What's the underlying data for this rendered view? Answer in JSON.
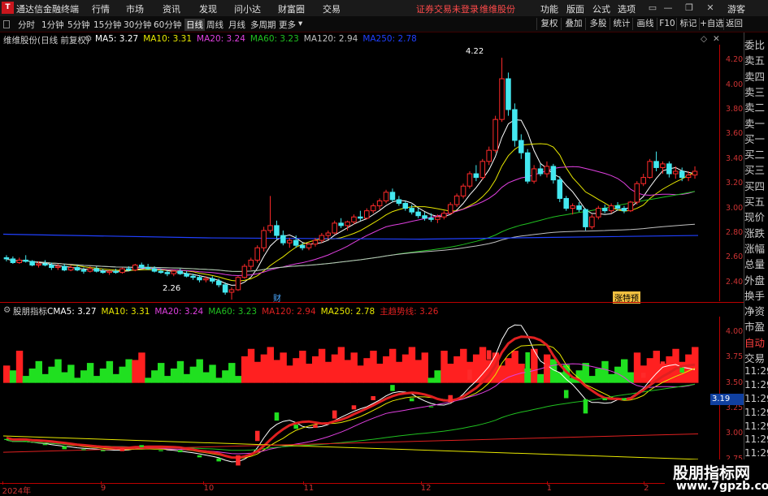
{
  "topbar": {
    "app_title": "通达信金融终端",
    "menus": [
      "行情",
      "市场",
      "资讯",
      "发现",
      "问小达",
      "财富圈",
      "交易"
    ],
    "status": "证券交易未登录",
    "stock_name": "维维股份",
    "right_menus": [
      "功能",
      "版面",
      "公式",
      "选项"
    ],
    "guest": "游客"
  },
  "periods": [
    "分时",
    "1分钟",
    "5分钟",
    "15分钟",
    "30分钟",
    "60分钟",
    "日线",
    "周线",
    "月线",
    "多周期",
    "更多"
  ],
  "active_period": "日线",
  "toolbar": [
    "复权",
    "叠加",
    "多股",
    "统计",
    "画线",
    "F10",
    "标记",
    "+自选",
    "返回"
  ],
  "main_legend": {
    "title": "维维股份(日线 前复权)",
    "ma": [
      {
        "label": "MA5: 3.27",
        "color": "#ffffff"
      },
      {
        "label": "MA10: 3.31",
        "color": "#e8e800"
      },
      {
        "label": "MA20: 3.24",
        "color": "#e040e0"
      },
      {
        "label": "MA60: 3.23",
        "color": "#20c020"
      },
      {
        "label": "MA120: 2.94",
        "color": "#c0c0c0"
      },
      {
        "label": "MA250: 2.78",
        "color": "#2040ff"
      }
    ]
  },
  "price_axis": [
    "4.20",
    "4.00",
    "3.80",
    "3.60",
    "3.40",
    "3.20",
    "3.00",
    "2.80",
    "2.60",
    "2.40"
  ],
  "annotations": {
    "high": "4.22",
    "low": "2.26",
    "cai": "财",
    "tag": "涨特预"
  },
  "sub_legend": {
    "title": "股朋指标",
    "ma": [
      {
        "label": "CMA5: 3.27",
        "color": "#ffffff"
      },
      {
        "label": "MA10: 3.31",
        "color": "#e8e800"
      },
      {
        "label": "MA20: 3.24",
        "color": "#e040e0"
      },
      {
        "label": "MA60: 3.23",
        "color": "#20c020"
      },
      {
        "label": "MA120: 2.94",
        "color": "#e02020"
      },
      {
        "label": "MA250: 2.78",
        "color": "#e8e800"
      },
      {
        "label": "主趋势线: 3.26",
        "color": "#e02020"
      }
    ]
  },
  "sub_axis": [
    "4.00",
    "3.75",
    "3.50",
    "3.25",
    "3.00",
    "2.75"
  ],
  "sub_price_box": "3.19",
  "x_axis": [
    {
      "label": "2024年",
      "pos": 0.003
    },
    {
      "label": "9",
      "pos": 0.14
    },
    {
      "label": "10",
      "pos": 0.283
    },
    {
      "label": "11",
      "pos": 0.422
    },
    {
      "label": "12",
      "pos": 0.585
    },
    {
      "label": "1",
      "pos": 0.76
    },
    {
      "label": "2",
      "pos": 0.895
    }
  ],
  "right_panel": [
    "委比",
    "卖五",
    "卖四",
    "卖三",
    "卖二",
    "卖一",
    "买一",
    "买二",
    "买三",
    "买四",
    "买五",
    "现价",
    "涨跌",
    "涨幅",
    "总量",
    "外盘",
    "换手",
    "净资",
    "市盈",
    "自动",
    "交易",
    "11:29",
    "11:29",
    "11:29",
    "11:29",
    "11:29",
    "11:29",
    "11:29",
    "11:29"
  ],
  "watermark": {
    "line1": "股朋指标网",
    "line2": "www.7gpzb.com"
  },
  "colors": {
    "up": "#ff2a2a",
    "down": "#44e8f0",
    "bull_bar": "#ff2020",
    "bear_bar": "#20e020"
  },
  "chart_data": {
    "type": "candlestick",
    "ylim": [
      2.3,
      4.3
    ],
    "candles": [
      [
        2.6,
        2.62,
        2.57,
        2.59
      ],
      [
        2.59,
        2.61,
        2.55,
        2.56
      ],
      [
        2.56,
        2.6,
        2.55,
        2.58
      ],
      [
        2.58,
        2.62,
        2.56,
        2.57
      ],
      [
        2.57,
        2.58,
        2.53,
        2.54
      ],
      [
        2.54,
        2.57,
        2.52,
        2.55
      ],
      [
        2.55,
        2.58,
        2.53,
        2.54
      ],
      [
        2.54,
        2.56,
        2.5,
        2.52
      ],
      [
        2.52,
        2.55,
        2.5,
        2.53
      ],
      [
        2.53,
        2.55,
        2.49,
        2.5
      ],
      [
        2.5,
        2.54,
        2.49,
        2.52
      ],
      [
        2.52,
        2.54,
        2.49,
        2.5
      ],
      [
        2.5,
        2.52,
        2.47,
        2.49
      ],
      [
        2.49,
        2.53,
        2.48,
        2.51
      ],
      [
        2.51,
        2.53,
        2.48,
        2.49
      ],
      [
        2.49,
        2.51,
        2.47,
        2.48
      ],
      [
        2.48,
        2.5,
        2.46,
        2.49
      ],
      [
        2.49,
        2.51,
        2.47,
        2.48
      ],
      [
        2.48,
        2.52,
        2.47,
        2.51
      ],
      [
        2.51,
        2.53,
        2.49,
        2.5
      ],
      [
        2.5,
        2.55,
        2.49,
        2.54
      ],
      [
        2.54,
        2.56,
        2.51,
        2.52
      ],
      [
        2.52,
        2.55,
        2.5,
        2.51
      ],
      [
        2.51,
        2.53,
        2.48,
        2.49
      ],
      [
        2.49,
        2.51,
        2.47,
        2.48
      ],
      [
        2.48,
        2.5,
        2.45,
        2.47
      ],
      [
        2.47,
        2.5,
        2.45,
        2.49
      ],
      [
        2.49,
        2.51,
        2.46,
        2.47
      ],
      [
        2.47,
        2.49,
        2.44,
        2.45
      ],
      [
        2.45,
        2.47,
        2.42,
        2.44
      ],
      [
        2.44,
        2.46,
        2.4,
        2.42
      ],
      [
        2.42,
        2.45,
        2.4,
        2.43
      ],
      [
        2.43,
        2.45,
        2.39,
        2.41
      ],
      [
        2.41,
        2.43,
        2.36,
        2.38
      ],
      [
        2.38,
        2.4,
        2.3,
        2.32
      ],
      [
        2.32,
        2.36,
        2.26,
        2.34
      ],
      [
        2.34,
        2.45,
        2.33,
        2.44
      ],
      [
        2.44,
        2.55,
        2.43,
        2.53
      ],
      [
        2.53,
        2.6,
        2.5,
        2.58
      ],
      [
        2.58,
        2.7,
        2.56,
        2.68
      ],
      [
        2.68,
        2.85,
        2.65,
        2.82
      ],
      [
        2.82,
        3.1,
        2.8,
        2.86
      ],
      [
        2.86,
        2.9,
        2.75,
        2.78
      ],
      [
        2.78,
        2.82,
        2.7,
        2.72
      ],
      [
        2.72,
        2.76,
        2.68,
        2.74
      ],
      [
        2.74,
        2.78,
        2.68,
        2.7
      ],
      [
        2.7,
        2.72,
        2.66,
        2.68
      ],
      [
        2.68,
        2.72,
        2.66,
        2.71
      ],
      [
        2.71,
        2.76,
        2.69,
        2.74
      ],
      [
        2.74,
        2.8,
        2.72,
        2.78
      ],
      [
        2.78,
        2.82,
        2.75,
        2.8
      ],
      [
        2.8,
        2.9,
        2.79,
        2.88
      ],
      [
        2.88,
        2.92,
        2.84,
        2.86
      ],
      [
        2.86,
        2.9,
        2.82,
        2.89
      ],
      [
        2.89,
        2.95,
        2.87,
        2.93
      ],
      [
        2.93,
        2.98,
        2.9,
        2.92
      ],
      [
        2.92,
        3.0,
        2.91,
        2.98
      ],
      [
        2.98,
        3.04,
        2.96,
        3.02
      ],
      [
        3.02,
        3.08,
        2.99,
        3.06
      ],
      [
        3.06,
        3.15,
        3.04,
        3.13
      ],
      [
        3.13,
        3.16,
        3.05,
        3.07
      ],
      [
        3.07,
        3.1,
        3.02,
        3.04
      ],
      [
        3.04,
        3.06,
        2.98,
        3.0
      ],
      [
        3.0,
        3.03,
        2.95,
        2.97
      ],
      [
        2.97,
        3.0,
        2.92,
        2.94
      ],
      [
        2.94,
        2.97,
        2.9,
        2.92
      ],
      [
        2.92,
        2.96,
        2.89,
        2.91
      ],
      [
        2.91,
        2.95,
        2.88,
        2.93
      ],
      [
        2.93,
        2.98,
        2.91,
        2.96
      ],
      [
        2.96,
        3.05,
        2.95,
        3.03
      ],
      [
        3.03,
        3.12,
        3.01,
        3.1
      ],
      [
        3.1,
        3.2,
        3.08,
        3.18
      ],
      [
        3.18,
        3.3,
        3.16,
        3.28
      ],
      [
        3.28,
        3.35,
        3.22,
        3.25
      ],
      [
        3.25,
        3.4,
        3.23,
        3.38
      ],
      [
        3.38,
        3.5,
        3.35,
        3.47
      ],
      [
        3.47,
        3.75,
        3.45,
        3.72
      ],
      [
        3.72,
        4.22,
        3.7,
        4.05
      ],
      [
        4.05,
        4.1,
        3.75,
        3.8
      ],
      [
        3.8,
        3.85,
        3.5,
        3.55
      ],
      [
        3.55,
        3.6,
        3.4,
        3.45
      ],
      [
        3.45,
        3.48,
        3.2,
        3.22
      ],
      [
        3.22,
        3.35,
        3.2,
        3.32
      ],
      [
        3.32,
        3.36,
        3.26,
        3.28
      ],
      [
        3.28,
        3.38,
        3.25,
        3.34
      ],
      [
        3.34,
        3.36,
        3.2,
        3.23
      ],
      [
        3.23,
        3.26,
        3.05,
        3.08
      ],
      [
        3.08,
        3.1,
        2.98,
        3.0
      ],
      [
        3.0,
        3.04,
        2.95,
        3.02
      ],
      [
        3.02,
        3.05,
        2.97,
        2.99
      ],
      [
        2.99,
        3.0,
        2.82,
        2.85
      ],
      [
        2.85,
        2.95,
        2.83,
        2.93
      ],
      [
        2.93,
        3.02,
        2.91,
        3.0
      ],
      [
        3.0,
        3.03,
        2.96,
        2.98
      ],
      [
        2.98,
        3.04,
        2.96,
        3.02
      ],
      [
        3.02,
        3.05,
        2.98,
        3.0
      ],
      [
        3.0,
        3.02,
        2.96,
        2.98
      ],
      [
        2.98,
        3.06,
        2.97,
        3.05
      ],
      [
        3.05,
        3.22,
        3.03,
        3.2
      ],
      [
        3.2,
        3.28,
        3.18,
        3.25
      ],
      [
        3.25,
        3.4,
        3.24,
        3.38
      ],
      [
        3.38,
        3.46,
        3.3,
        3.33
      ],
      [
        3.33,
        3.38,
        3.28,
        3.36
      ],
      [
        3.36,
        3.38,
        3.25,
        3.28
      ],
      [
        3.28,
        3.34,
        3.24,
        3.3
      ],
      [
        3.3,
        3.33,
        3.22,
        3.25
      ],
      [
        3.25,
        3.3,
        3.22,
        3.27
      ],
      [
        3.27,
        3.34,
        3.24,
        3.3
      ]
    ]
  }
}
